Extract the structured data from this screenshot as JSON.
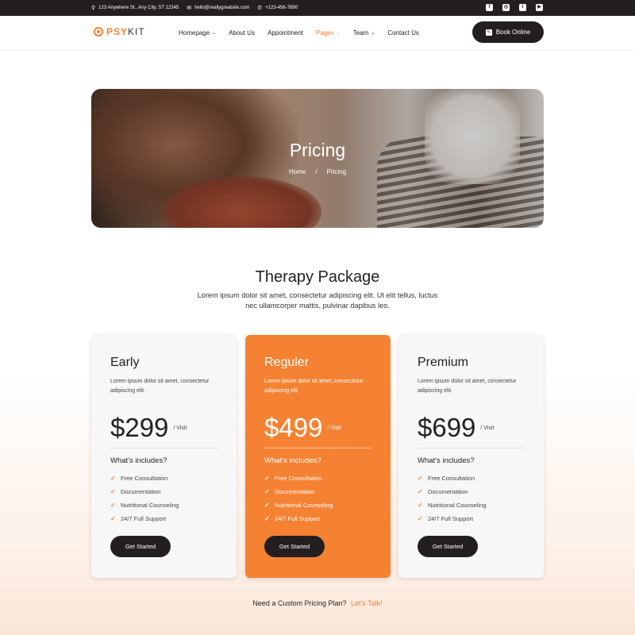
{
  "topbar": {
    "address": "123 Anywhere St., Any City, ST 12345",
    "email": "hello@reallygreatsite.com",
    "phone": "+123-456-7890",
    "social": [
      {
        "icon": "facebook-icon",
        "glyph": "f"
      },
      {
        "icon": "instagram-icon",
        "glyph": "◎"
      },
      {
        "icon": "twitter-icon",
        "glyph": "t"
      },
      {
        "icon": "youtube-icon",
        "glyph": "▶"
      }
    ]
  },
  "nav": {
    "logo_a": "PSY",
    "logo_b": "KIT",
    "items": [
      {
        "label": "Homepage",
        "dropdown": true
      },
      {
        "label": "About Us",
        "dropdown": false
      },
      {
        "label": "Appointment",
        "dropdown": false
      },
      {
        "label": "Pages",
        "dropdown": true,
        "active": true
      },
      {
        "label": "Team",
        "dropdown": true
      },
      {
        "label": "Contact Us",
        "dropdown": false
      }
    ],
    "cta": "Book Online"
  },
  "hero": {
    "title": "Pricing",
    "breadcrumb_home": "Home",
    "breadcrumb_sep": "/",
    "breadcrumb_current": "Pricing"
  },
  "section": {
    "title": "Therapy Package",
    "description": "Lorem ipsum dolor sit amet, consectetur adipiscing elit. Ut elit tellus, luctus nec ullamcorper mattis, pulvinar dapibus leo."
  },
  "plans": [
    {
      "name": "Early",
      "description": "Lorem ipsum dolor sit amet, consectetur adipiscing elit.",
      "price": "$299",
      "per": "/ Visit",
      "includes_title": "What's includes?",
      "features": [
        "Free Consultation",
        "Documentation",
        "Nutritional Counseling",
        "24/7 Full Support"
      ],
      "button": "Get Started"
    },
    {
      "name": "Reguler",
      "description": "Lorem ipsum dolor sit amet, consectetur adipiscing elit.",
      "price": "$499",
      "per": "/ Visit",
      "includes_title": "What's includes?",
      "features": [
        "Free Consultation",
        "Documentation",
        "Nutritional Counseling",
        "24/7 Full Support"
      ],
      "button": "Get Started",
      "highlight": true
    },
    {
      "name": "Premium",
      "description": "Lorem ipsum dolor sit amet, consectetur adipiscing elit.",
      "price": "$699",
      "per": "/ Visit",
      "includes_title": "What's includes?",
      "features": [
        "Free Consultation",
        "Documentation",
        "Nutritional Counseling",
        "24/7 Full Support"
      ],
      "button": "Get Started"
    }
  ],
  "custom": {
    "text": "Need a Custom Pricing Plan?",
    "link": "Let's Talk!"
  },
  "colors": {
    "accent": "#f58233",
    "dark": "#231f20"
  }
}
